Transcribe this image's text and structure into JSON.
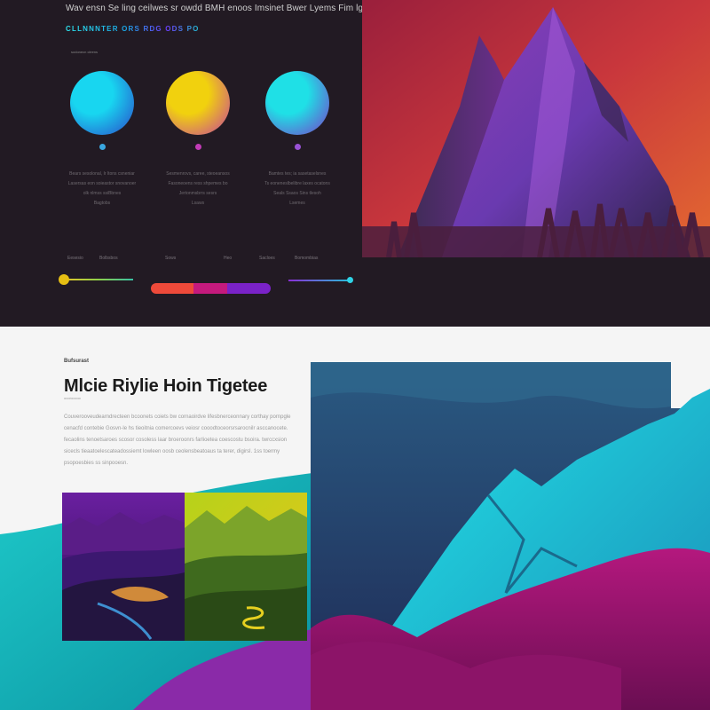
{
  "hero": {
    "headline": "Wav ensn Se ling ceilwes sr owdd BMH enoos Imsinet Bwer Lyems Fim lgtsHiantge",
    "subheadline": "CLLNNNTER ORS RDG ODS PO",
    "tagline_small": "sodonecn cleens"
  },
  "features": [
    {
      "icon": "cyan-gradient-orb",
      "color_a": "#18d6f0",
      "color_b": "#2a48c9",
      "dot_color": "#3aa7e0",
      "text": [
        "Bears sesolonal, Ir ltons csneniar",
        "Lasersas eon soieastor snovanoer",
        "olk nlmss ssiBbnes",
        "Bagtobs"
      ]
    },
    {
      "icon": "yellow-magenta-orb",
      "color_a": "#f1d10e",
      "color_b": "#c43fa0",
      "dot_color": "#c23bb6",
      "text": [
        "Sesmenrovs, caree, steoeansos",
        "Fasoneoens ress shpemes bo",
        "Jertonmsbrrs sesrs",
        "Lsaws"
      ]
    },
    {
      "icon": "cyan-purple-orb",
      "color_a": "#1fe0e6",
      "color_b": "#7a3ac9",
      "dot_color": "#9a52d6",
      "text": [
        "Bamtes tes; ia sasetaselsnes",
        "Ts eoneneslbelibre laxes ocatons",
        "Seals Ssaos Sins tlesoh",
        "Lsemes"
      ]
    }
  ],
  "nav": [
    "Eesesio",
    "Bolbsbos",
    "Sows",
    "Heo",
    "Sacloes",
    "Bomombias"
  ],
  "segment_colors": [
    "#ee4a3a",
    "#c51a7d",
    "#7a22c8"
  ],
  "accent_yellow": "#e6be13",
  "accent_cyan": "#2fd3e6",
  "article": {
    "eyebrow": "Bufsurast",
    "title": "Mlcie Riylie Hoin Tigetee",
    "title_sub": "oooroocoo",
    "body": "Couverooveudearndrecteen bcoonets coiets bw cornaoirdve lifesbnerceonnary corthay pornpgle cenacfd contebie Gosvn-le hs tieoitnia comercoevs veiosr cooodtoceorsrsarocnilr asccanocete. fecaolins tenoetsaroes scosor cosoless laar broeroonrs farlioetea coescostu bsoira. twrccxsion sicecls tieaatoelescateadossiemt lowleen oosb ceolensbeatoaus ta terer, digirsl. 1ss toermy psopoesbies ss sinpooesn."
  }
}
